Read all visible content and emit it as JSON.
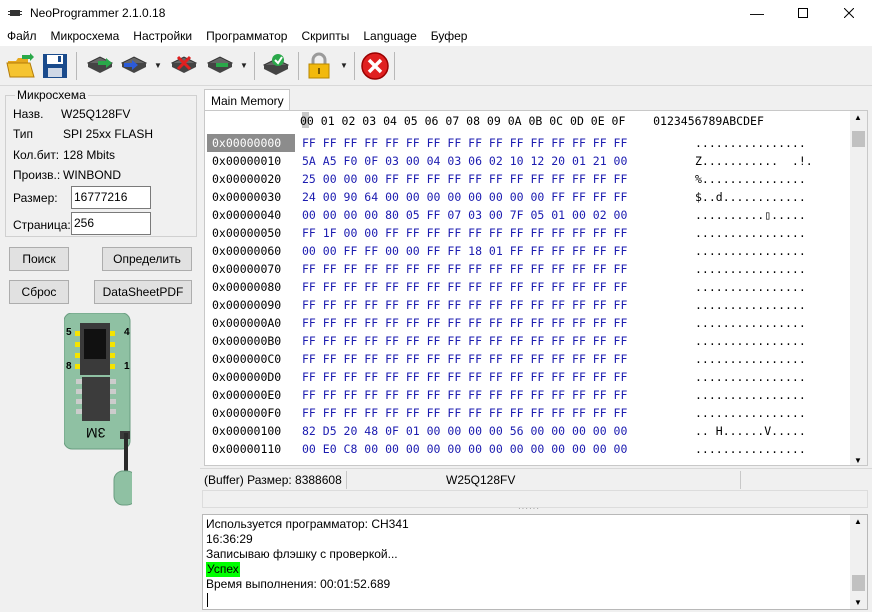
{
  "window": {
    "title": "NeoProgrammer 2.1.0.18"
  },
  "menu": [
    "Файл",
    "Микросхема",
    "Настройки",
    "Программатор",
    "Скрипты",
    "Language",
    "Буфер"
  ],
  "chip_group": {
    "title": "Микросхема",
    "name_label": "Назв.",
    "name_value": "W25Q128FV",
    "type_label": "Тип",
    "type_value": "SPI 25xx FLASH",
    "bits_label": "Кол.бит:",
    "bits_value": "128 Mbits",
    "vendor_label": "Произв.:",
    "vendor_value": "WINBOND",
    "size_label": "Размер:",
    "size_value": "16777216",
    "page_label": "Страница:",
    "page_value": "256"
  },
  "buttons": {
    "search": "Поиск",
    "detect": "Определить",
    "reset": "Сброс",
    "datasheet": "DataSheetPDF"
  },
  "adapter_label": "3M",
  "pin_labels": [
    "5",
    "4",
    "8",
    "1"
  ],
  "tab": "Main Memory",
  "hex": {
    "header": "00 01 02 03 04 05 06 07 08 09 0A 0B 0C 0D 0E 0F    0123456789ABCDEF",
    "rows": [
      {
        "addr": "0x00000000",
        "bytes": "FF FF FF FF FF FF FF FF FF FF FF FF FF FF FF FF",
        "ascii": "................"
      },
      {
        "addr": "0x00000010",
        "bytes": "5A A5 F0 0F 03 00 04 03 06 02 10 12 20 01 21 00",
        "ascii": "Z...........  .!."
      },
      {
        "addr": "0x00000020",
        "bytes": "25 00 00 00 FF FF FF FF FF FF FF FF FF FF FF FF",
        "ascii": "%..............."
      },
      {
        "addr": "0x00000030",
        "bytes": "24 00 90 64 00 00 00 00 00 00 00 00 FF FF FF FF",
        "ascii": "$..d............"
      },
      {
        "addr": "0x00000040",
        "bytes": "00 00 00 00 80 05 FF 07 03 00 7F 05 01 00 02 00",
        "ascii": "..........▯....."
      },
      {
        "addr": "0x00000050",
        "bytes": "FF 1F 00 00 FF FF FF FF FF FF FF FF FF FF FF FF",
        "ascii": "................"
      },
      {
        "addr": "0x00000060",
        "bytes": "00 00 FF FF 00 00 FF FF 18 01 FF FF FF FF FF FF",
        "ascii": "................"
      },
      {
        "addr": "0x00000070",
        "bytes": "FF FF FF FF FF FF FF FF FF FF FF FF FF FF FF FF",
        "ascii": "................"
      },
      {
        "addr": "0x00000080",
        "bytes": "FF FF FF FF FF FF FF FF FF FF FF FF FF FF FF FF",
        "ascii": "................"
      },
      {
        "addr": "0x00000090",
        "bytes": "FF FF FF FF FF FF FF FF FF FF FF FF FF FF FF FF",
        "ascii": "................"
      },
      {
        "addr": "0x000000A0",
        "bytes": "FF FF FF FF FF FF FF FF FF FF FF FF FF FF FF FF",
        "ascii": "................"
      },
      {
        "addr": "0x000000B0",
        "bytes": "FF FF FF FF FF FF FF FF FF FF FF FF FF FF FF FF",
        "ascii": "................"
      },
      {
        "addr": "0x000000C0",
        "bytes": "FF FF FF FF FF FF FF FF FF FF FF FF FF FF FF FF",
        "ascii": "................"
      },
      {
        "addr": "0x000000D0",
        "bytes": "FF FF FF FF FF FF FF FF FF FF FF FF FF FF FF FF",
        "ascii": "................"
      },
      {
        "addr": "0x000000E0",
        "bytes": "FF FF FF FF FF FF FF FF FF FF FF FF FF FF FF FF",
        "ascii": "................"
      },
      {
        "addr": "0x000000F0",
        "bytes": "FF FF FF FF FF FF FF FF FF FF FF FF FF FF FF FF",
        "ascii": "................"
      },
      {
        "addr": "0x00000100",
        "bytes": "82 D5 20 48 0F 01 00 00 00 00 56 00 00 00 00 00",
        "ascii": ".. H......V....."
      },
      {
        "addr": "0x00000110",
        "bytes": "00 E0 C8 00 00 00 00 00 00 00 00 00 00 00 00 00",
        "ascii": "................"
      }
    ]
  },
  "status": {
    "buffer": "(Buffer) Размер: 8388608",
    "chip": "W25Q128FV"
  },
  "log": [
    "Используется программатор: CH341",
    "16:36:29",
    "Записываю флэшку с проверкой...",
    "Успех",
    "Время выполнения: 00:01:52.689"
  ],
  "colors": {
    "hex_bytes": "#1b1bb0",
    "success": "#00ff00",
    "selected_addr": "#8c8c8c",
    "close_red": "#e02020"
  }
}
